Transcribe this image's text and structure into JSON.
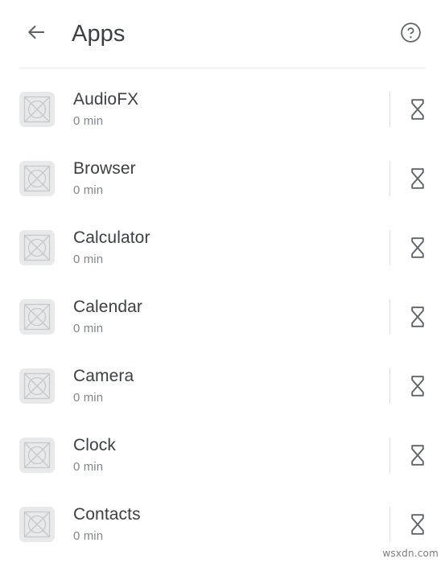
{
  "appbar": {
    "back_icon": "arrow-left-icon",
    "title": "Apps",
    "help_icon": "help-circle-icon"
  },
  "list": {
    "thumbnail_icon": "broken-image-placeholder-icon",
    "timer_icon": "hourglass-icon",
    "rows": [
      {
        "name": "AudioFX",
        "usage": "0 min"
      },
      {
        "name": "Browser",
        "usage": "0 min"
      },
      {
        "name": "Calculator",
        "usage": "0 min"
      },
      {
        "name": "Calendar",
        "usage": "0 min"
      },
      {
        "name": "Camera",
        "usage": "0 min"
      },
      {
        "name": "Clock",
        "usage": "0 min"
      },
      {
        "name": "Contacts",
        "usage": "0 min"
      }
    ]
  },
  "watermark": "wsxdn.com",
  "colors": {
    "background": "#ffffff",
    "primary_text": "#3c4043",
    "secondary_text": "#80868b",
    "icon": "#5f6368",
    "divider": "#e9eaec",
    "thumb_bg": "#e7e9ea",
    "thumb_stroke": "#c6c9cb"
  }
}
